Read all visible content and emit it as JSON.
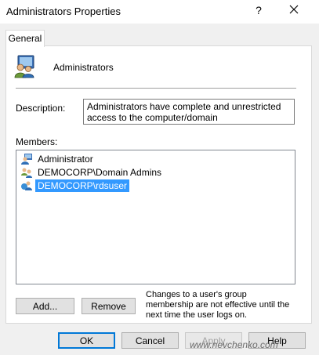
{
  "window": {
    "title": "Administrators Properties",
    "help_glyph": "?",
    "close_glyph": "✕"
  },
  "tabs": [
    {
      "label": "General",
      "active": true
    }
  ],
  "group": {
    "name": "Administrators",
    "icon": "group-users-icon"
  },
  "description": {
    "label": "Description:",
    "value": "Administrators have complete and unrestricted access to the computer/domain"
  },
  "members": {
    "label": "Members:",
    "items": [
      {
        "name": "Administrator",
        "icon": "user-icon",
        "selected": false
      },
      {
        "name": "DEMOCORP\\Domain Admins",
        "icon": "domain-group-icon",
        "selected": false
      },
      {
        "name": "DEMOCORP\\rdsuser",
        "icon": "domain-user-icon",
        "selected": true
      }
    ]
  },
  "buttons": {
    "add": "Add...",
    "remove": "Remove",
    "ok": "OK",
    "cancel": "Cancel",
    "apply": "Apply",
    "help": "Help"
  },
  "note": "Changes to a user's group membership are not effective until the next time the user logs on.",
  "watermark": "www.nevchenko.com",
  "colors": {
    "selection": "#3399ff",
    "dialog_bg": "#f0f0f0",
    "default_button_border": "#0078d7"
  }
}
